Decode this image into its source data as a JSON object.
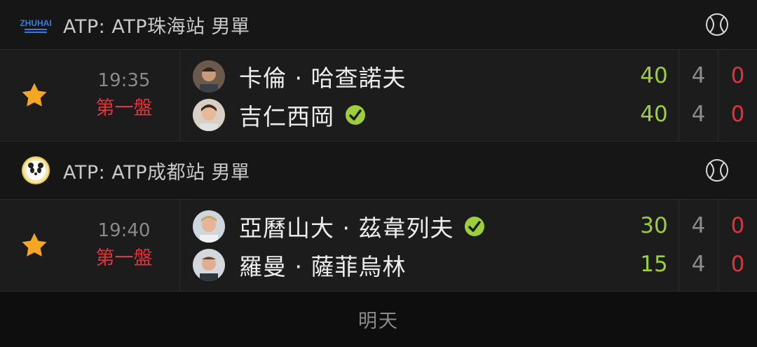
{
  "tournaments": [
    {
      "title": "ATP: ATP珠海站 男單",
      "logo_icon": "zhuhai-championships-logo",
      "logo_text": "ZHUHAI",
      "match": {
        "time": "19:35",
        "status": "第一盤",
        "players": [
          {
            "name": "卡倫 · 哈查諾夫",
            "serving": false,
            "points": "40",
            "games": "4",
            "sets": "0"
          },
          {
            "name": "吉仁西岡",
            "serving": true,
            "points": "40",
            "games": "4",
            "sets": "0"
          }
        ]
      }
    },
    {
      "title": "ATP: ATP成都站 男單",
      "logo_icon": "chengdu-open-panda-logo",
      "match": {
        "time": "19:40",
        "status": "第一盤",
        "players": [
          {
            "name": "亞曆山大 · 茲韋列夫",
            "serving": true,
            "points": "30",
            "games": "4",
            "sets": "0"
          },
          {
            "name": "羅曼 · 薩菲烏林",
            "serving": false,
            "points": "15",
            "games": "4",
            "sets": "0"
          }
        ]
      }
    }
  ],
  "footer": {
    "label": "明天"
  },
  "colors": {
    "points": "#9ccf3a",
    "sets": "#e0333a",
    "status": "#e0333a",
    "star": "#f5a623",
    "serve": "#9ccf3a"
  }
}
